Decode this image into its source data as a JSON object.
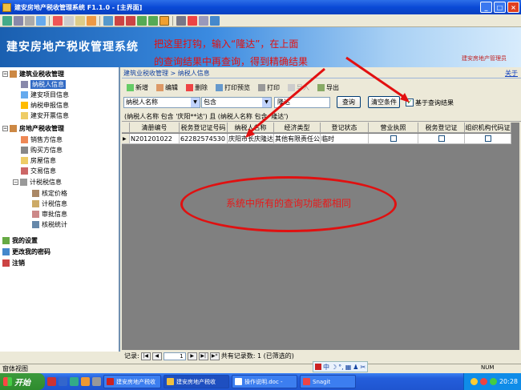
{
  "window": {
    "title": "建安房地产税收管理系统 F1.1.0 - [主界面]"
  },
  "banner": {
    "title": "建安房地产税收管理系统",
    "user_text": "建安房地产管理员"
  },
  "annotation_top": {
    "line1": "把这里打钩，输入“隆达”，在上面",
    "line2": "的查询结果中再查询，得到精确结果"
  },
  "annotation_center": "系统中所有的查询功能都相同",
  "help_link": "关于",
  "sidebar": {
    "groups": [
      {
        "label": "建筑业税收管理",
        "expanded": "−"
      },
      {
        "label": "房地产税收管理",
        "expanded": "−"
      },
      {
        "label": "我的设置"
      },
      {
        "label": "更改我的密码"
      },
      {
        "label": "注销"
      }
    ],
    "construction_items": [
      "纳税人信息",
      "建安项目信息",
      "纳税申报信息",
      "建安开票信息"
    ],
    "realestate_items": [
      "销售方信息",
      "购买方信息",
      "房屋信息",
      "交易信息"
    ],
    "tax_group": "计税税信息",
    "tax_items": [
      "核定价格",
      "计税信息",
      "审批信息",
      "核税统计"
    ]
  },
  "breadcrumb": "建筑业税收管理 > 纳税人信息",
  "actions": {
    "add": "新增",
    "edit": "编辑",
    "delete": "删除",
    "print_preview": "打印预览",
    "print": "打印",
    "import": "导入",
    "export": "导出"
  },
  "search": {
    "field": "纳税人名称",
    "operator": "包含",
    "value": "隆达",
    "query_button": "查询",
    "clear_button": "清空条件",
    "base_on_result_label": "基于查询结果",
    "base_on_result_checked": "✓"
  },
  "query_description": "(纳税人名称 包含 '庆阳**达') 且 (纳税人名称 包含 '隆达')",
  "grid": {
    "columns": [
      "清册编号",
      "税务登记证号码",
      "纳税人名称",
      "经济类型",
      "登记状态",
      "营业执照",
      "税务登记证",
      "组织机构代码证"
    ],
    "rows": [
      {
        "indicator": "▶",
        "cells": [
          "N201201022",
          "62282574530",
          "庆阳市长庆隆达",
          "其他有限责任公",
          "临时",
          "",
          "",
          ""
        ]
      }
    ]
  },
  "pager": {
    "label": "记录:",
    "current_page": "1",
    "summary": "共有记录数: 1 (已筛选的)"
  },
  "statusbar": {
    "text": "窗体视图",
    "ime_label": "中",
    "num": "NUM"
  },
  "taskbar": {
    "start": "开始",
    "tasks": [
      "建安房地产税收",
      "建安房地产税收",
      "操作说明.doc -",
      "Snagit"
    ],
    "clock": "20:28"
  },
  "colors": {
    "annotation_red": "#e21010",
    "selection_blue": "#316ac5",
    "grid_background": "#808080"
  }
}
